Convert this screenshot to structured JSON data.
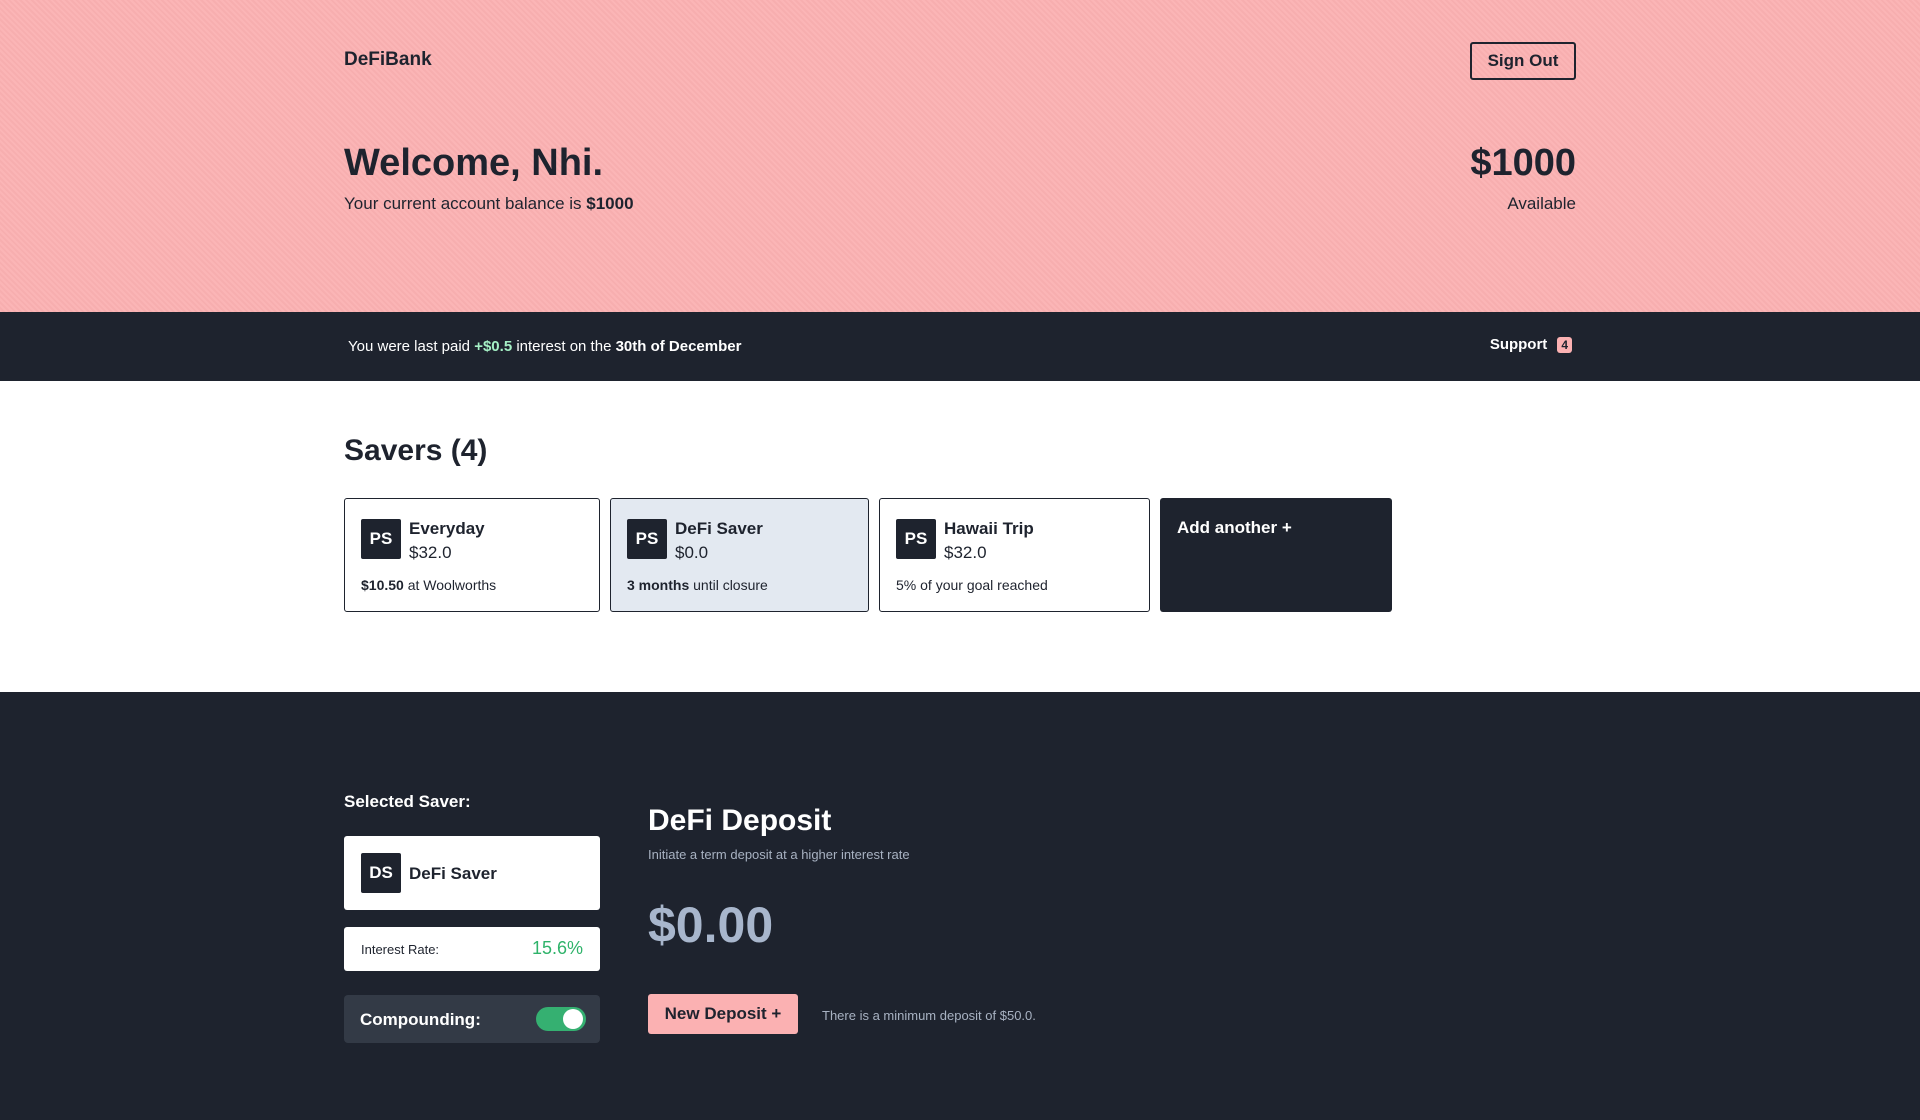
{
  "header": {
    "brand": "DeFiBank",
    "sign_out_label": "Sign Out",
    "welcome": "Welcome, Nhi.",
    "balance_text": "Your current account balance is",
    "balance_value": "$1000",
    "big_balance": "$1000",
    "available_label": "Available"
  },
  "info_bar": {
    "paid_prefix": "You were last paid",
    "paid_amount": "+$0.5",
    "paid_middle": "interest on the",
    "paid_date": "30th of December",
    "support_label": "Support",
    "support_count": "4"
  },
  "savers": {
    "title": "Savers (4)",
    "cards": [
      {
        "initials": "PS",
        "name": "Everyday",
        "balance": "$32.0",
        "note_bold": "$10.50",
        "note_rest": " at Woolworths"
      },
      {
        "initials": "PS",
        "name": "DeFi Saver",
        "balance": "$0.0",
        "note_bold": "3 months",
        "note_rest": " until closure"
      },
      {
        "initials": "PS",
        "name": "Hawaii Trip",
        "balance": "$32.0",
        "note_bold": "",
        "note_rest": "5% of your goal reached"
      }
    ],
    "add_label": "Add another +"
  },
  "selected": {
    "label": "Selected Saver:",
    "initials": "DS",
    "name": "DeFi Saver",
    "interest_label": "Interest Rate:",
    "interest_value": "15.6%",
    "compounding_label": "Compounding:",
    "compounding_on": true
  },
  "deposit": {
    "title": "DeFi Deposit",
    "subtitle": "Initiate a term deposit at a higher interest rate",
    "amount": "$0.00",
    "button_label": "New Deposit +",
    "minimum_note": "There is a minimum deposit of $50.0."
  },
  "colors": {
    "accent_pink": "#fbb1b2",
    "dark_navy": "#1e232e",
    "positive_green": "#2fb36a"
  }
}
